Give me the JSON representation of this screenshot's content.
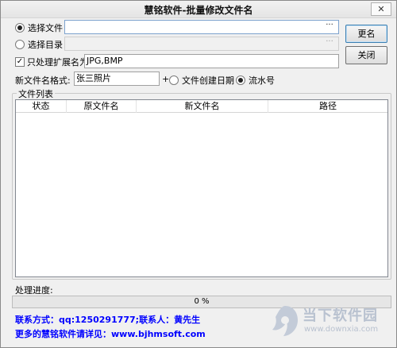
{
  "window": {
    "title": "慧铭软件-批量修改文件名",
    "close_glyph": "✕"
  },
  "source": {
    "file_label": "选择文件",
    "dir_label": "选择目录",
    "file_path": "",
    "dir_path": "",
    "browse_glyph": "···",
    "selected": "file"
  },
  "filter": {
    "checked": true,
    "label": "只处理扩展名为",
    "value": "JPG,BMP"
  },
  "format": {
    "label": "新文件名格式:",
    "value": "张三照片",
    "plus": "+",
    "opt_date": "文件创建日期",
    "opt_seq": "流水号",
    "selected": "seq"
  },
  "buttons": {
    "rename": "更名",
    "close": "关闭"
  },
  "file_list": {
    "group_label": "文件列表",
    "columns": [
      "状态",
      "原文件名",
      "新文件名",
      "路径"
    ],
    "rows": []
  },
  "progress": {
    "label": "处理进度:",
    "percent": 0,
    "text": "0 %"
  },
  "contact": {
    "line1": "联系方式：qq:1250291777;联系人：黄先生",
    "line2": "更多的慧铭软件请详见：www.bjhmsoft.com"
  },
  "watermark": {
    "text": "当下软件园",
    "url": "www.downxia.com"
  }
}
